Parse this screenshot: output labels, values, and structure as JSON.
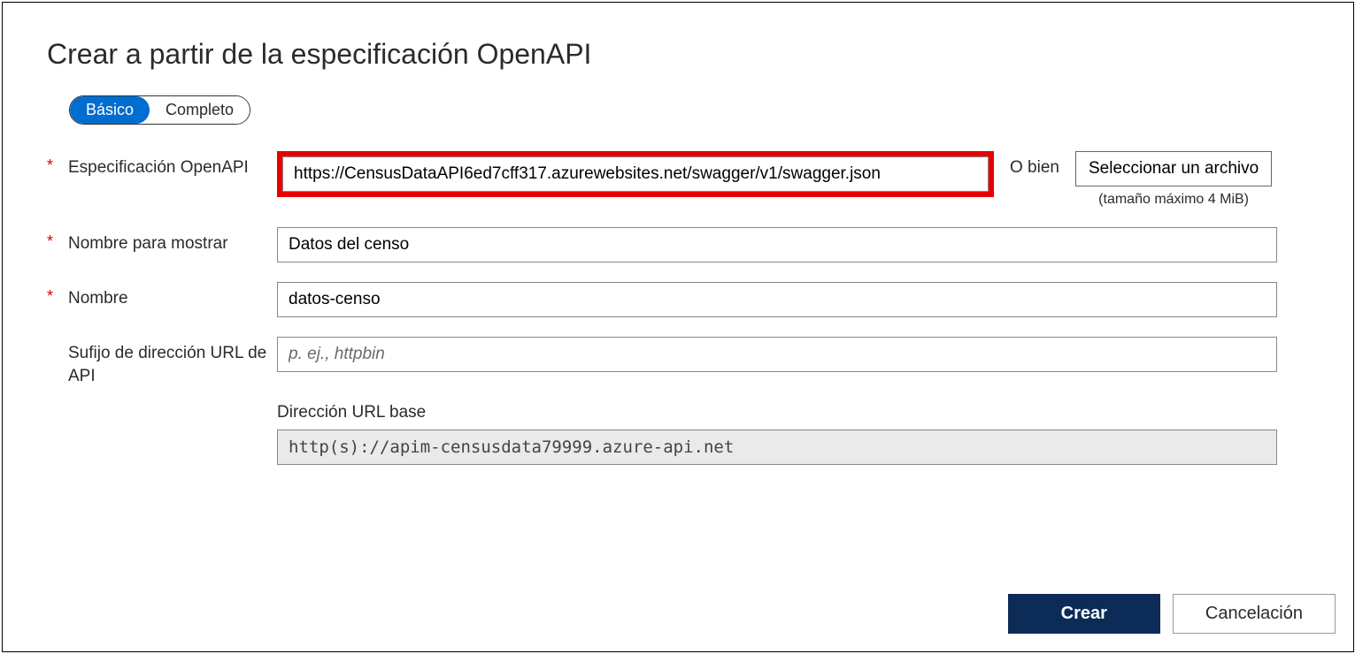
{
  "title": "Crear a partir de la especificación OpenAPI",
  "toggle": {
    "basic": "Básico",
    "full": "Completo"
  },
  "fields": {
    "spec": {
      "label": "Especificación OpenAPI",
      "value": "https://CensusDataAPI6ed7cff317.azurewebsites.net/swagger/v1/swagger.json",
      "or": "O bien",
      "fileBtn": "Seleccionar un archivo",
      "fileHint": "(tamaño máximo 4 MiB)"
    },
    "displayName": {
      "label": "Nombre para mostrar",
      "value": "Datos del censo"
    },
    "name": {
      "label": "Nombre",
      "value": "datos-censo"
    },
    "suffix": {
      "label": "Sufijo de dirección URL de API",
      "placeholder": "p. ej., httpbin",
      "value": ""
    },
    "baseUrl": {
      "label": "Dirección URL base",
      "value": "http(s)://apim-censusdata79999.azure-api.net"
    }
  },
  "buttons": {
    "create": "Crear",
    "cancel": "Cancelación"
  },
  "requiredMark": "*"
}
